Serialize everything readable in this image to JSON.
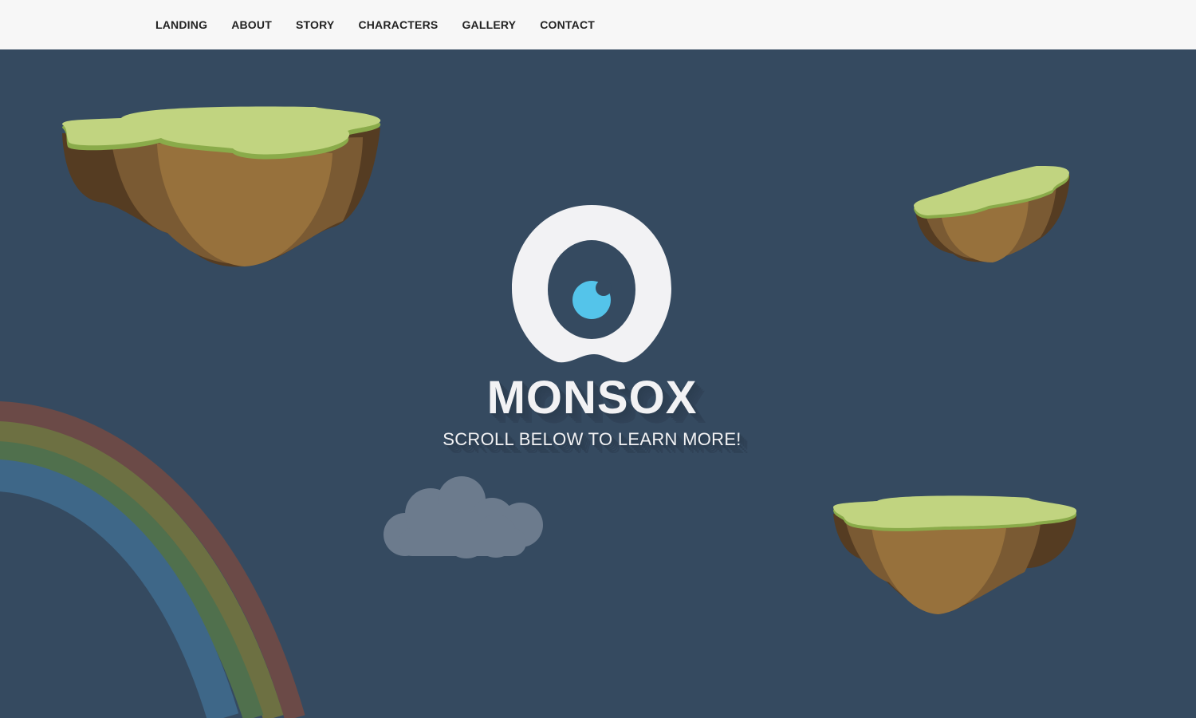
{
  "nav": {
    "items": [
      {
        "label": "LANDING"
      },
      {
        "label": "ABOUT"
      },
      {
        "label": "STORY"
      },
      {
        "label": "CHARACTERS"
      },
      {
        "label": "GALLERY"
      },
      {
        "label": "CONTACT"
      }
    ]
  },
  "hero": {
    "title": "MONSOX",
    "subtitle": "SCROLL BELOW TO LEARN MORE!"
  },
  "colors": {
    "background": "#354a60",
    "navbar": "#f7f7f7",
    "grass": "#c1d480",
    "grass_edge": "#8aab4a",
    "dirt_light": "#97713c",
    "dirt_mid": "#7a5a33",
    "dirt_dark": "#553c22",
    "eye_white": "#f2f2f4",
    "pupil": "#54c4ea",
    "cloud": "#6c7b8d"
  }
}
